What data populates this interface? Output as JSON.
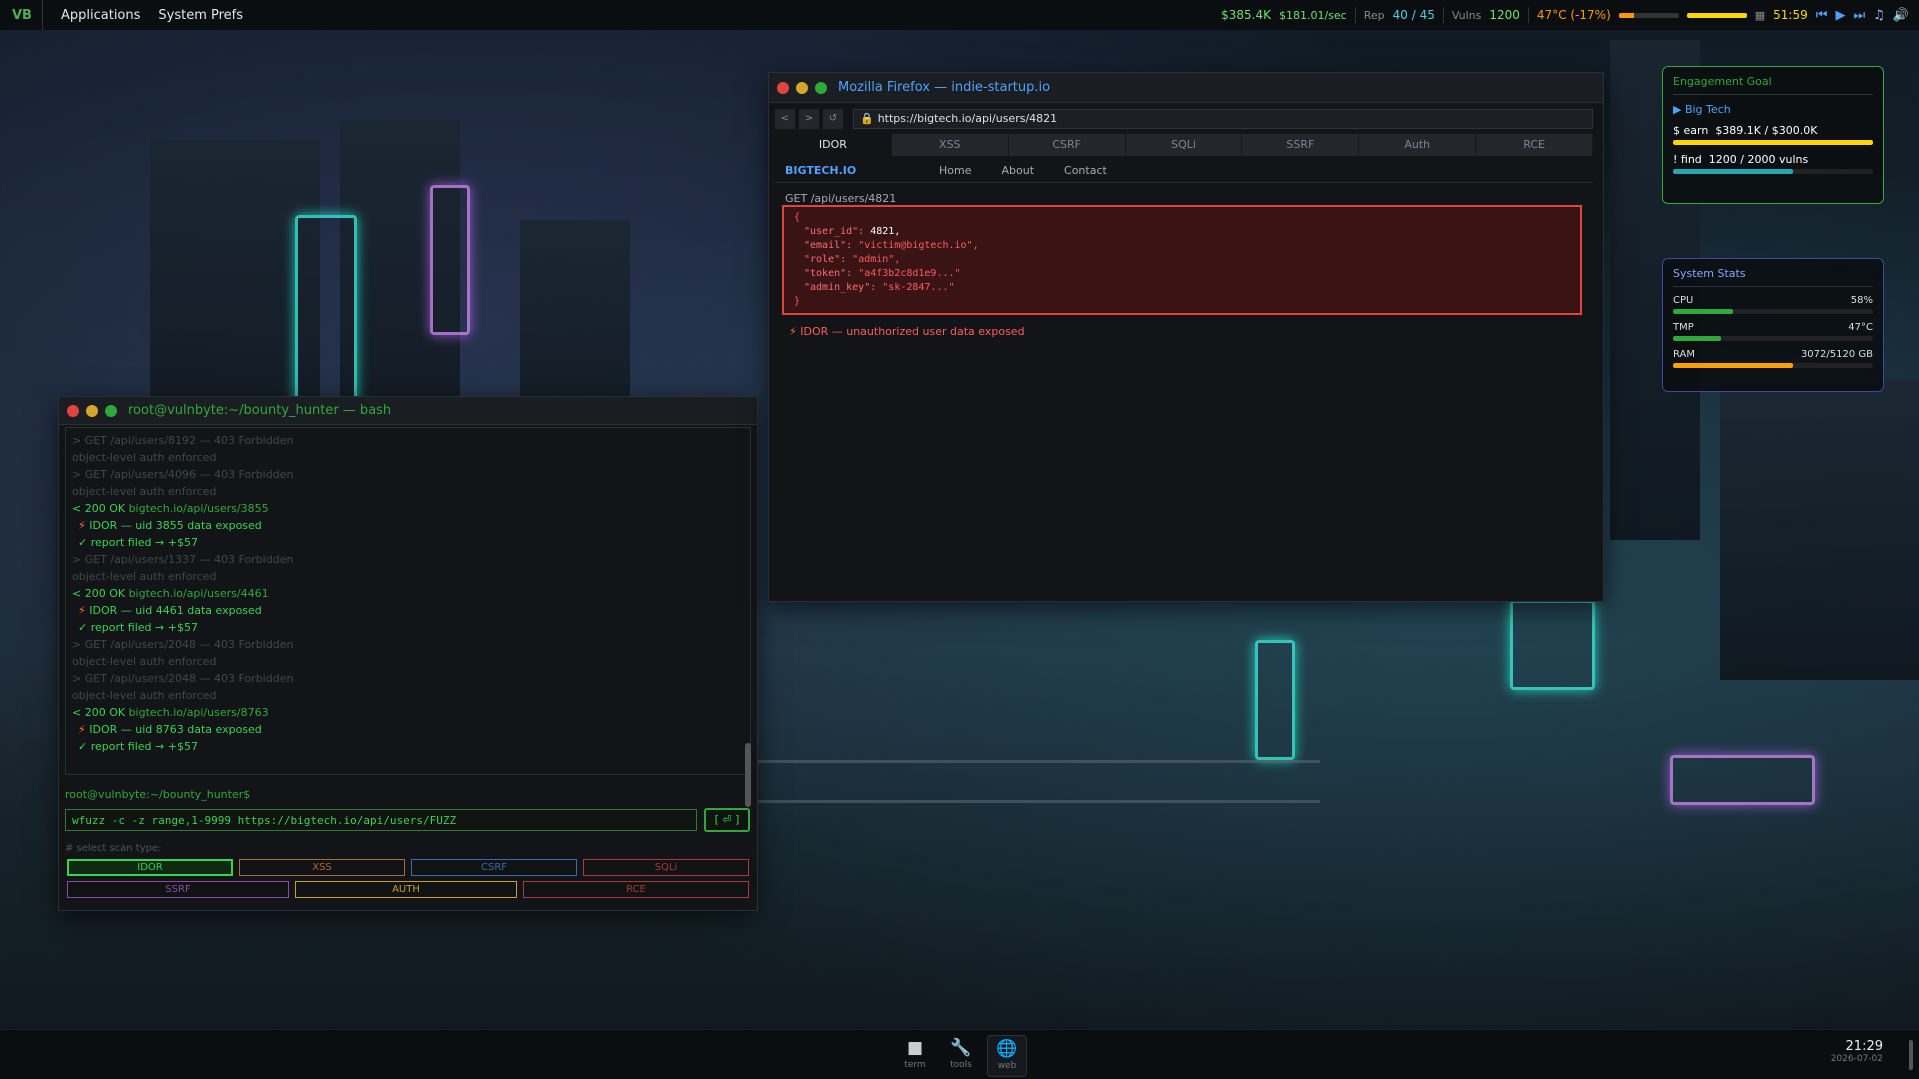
{
  "topbar": {
    "logo": "VB",
    "menus": [
      "Applications",
      "System Prefs"
    ],
    "money": "$385.4K",
    "rate": "$181.01/sec",
    "rep_label": "Rep",
    "rep_value": "40 / 45",
    "vulns_label": "Vulns",
    "vulns_value": "1200",
    "temp": "47°C (-17%)",
    "timer": "51:59"
  },
  "terminal": {
    "title": "root@vulnbyte:~/bounty_hunter — bash",
    "log": [
      {
        "type": "dim",
        "text": "> GET /api/users/8192 — 403 Forbidden"
      },
      {
        "type": "dim",
        "text": "  object-level auth enforced"
      },
      {
        "type": "dim",
        "text": "> GET /api/users/4096 — 403 Forbidden"
      },
      {
        "type": "dim",
        "text": "  object-level auth enforced"
      },
      {
        "type": "ok",
        "status": "< 200 OK",
        "host": "bigtech.io/api/users/3855"
      },
      {
        "type": "idor",
        "text": "IDOR — uid 3855 data exposed"
      },
      {
        "type": "report",
        "text": "✓ report filed → +$57"
      },
      {
        "type": "dim",
        "text": "> GET /api/users/1337 — 403 Forbidden"
      },
      {
        "type": "dim",
        "text": "  object-level auth enforced"
      },
      {
        "type": "ok",
        "status": "< 200 OK",
        "host": "bigtech.io/api/users/4461"
      },
      {
        "type": "idor",
        "text": "IDOR — uid 4461 data exposed"
      },
      {
        "type": "report",
        "text": "✓ report filed → +$57"
      },
      {
        "type": "dim",
        "text": "> GET /api/users/2048 — 403 Forbidden"
      },
      {
        "type": "dim",
        "text": "  object-level auth enforced"
      },
      {
        "type": "dim",
        "text": "> GET /api/users/2048 — 403 Forbidden"
      },
      {
        "type": "dim",
        "text": "  object-level auth enforced"
      },
      {
        "type": "ok",
        "status": "< 200 OK",
        "host": "bigtech.io/api/users/8763"
      },
      {
        "type": "idor",
        "text": "IDOR — uid 8763 data exposed"
      },
      {
        "type": "report",
        "text": "✓ report filed → +$57"
      }
    ],
    "prompt": "root@vulnbyte:~/bounty_hunter$",
    "command": "wfuzz -c -z range,1-9999 https://bigtech.io/api/users/FUZZ",
    "run_label": "[ ⏎ ]",
    "scan_label": "# select scan type:",
    "scan_types": [
      {
        "label": "IDOR",
        "color": "#39d353",
        "active": true
      },
      {
        "label": "XSS",
        "color": "#b0673a"
      },
      {
        "label": "CSRF",
        "color": "#3f6aa8"
      },
      {
        "label": "SQLi",
        "color": "#a83a3a"
      },
      {
        "label": "SSRF",
        "color": "#8a4aa8"
      },
      {
        "label": "AUTH",
        "color": "#c8a02a"
      },
      {
        "label": "RCE",
        "color": "#a83a3a"
      }
    ]
  },
  "firefox": {
    "title": "Mozilla Firefox — indie-startup.io",
    "nav": [
      "<",
      ">",
      "↺"
    ],
    "url": "https://bigtech.io/api/users/4821",
    "tabs": [
      "IDOR",
      "XSS",
      "CSRF",
      "SQLi",
      "SSRF",
      "Auth",
      "RCE"
    ],
    "site_logo": "BIGTECH.IO",
    "site_links": [
      "Home",
      "About",
      "Contact"
    ],
    "request": "GET /api/users/4821",
    "json_open": "{",
    "json_lines": [
      {
        "key": "\"user_id\": ",
        "value": "4821,",
        "num": true
      },
      {
        "key": "\"email\": ",
        "value": "\"victim@bigtech.io\","
      },
      {
        "key": "\"role\": ",
        "value": "\"admin\","
      },
      {
        "key": "\"token\": ",
        "value": "\"a4f3b2c8d1e9...\""
      },
      {
        "key": "\"admin_key\": ",
        "value": "\"sk-2847...\""
      }
    ],
    "json_close": "}",
    "alert": "IDOR — unauthorized user data exposed"
  },
  "engagement": {
    "title": "Engagement Goal",
    "target": "▶ Big Tech",
    "earn_label": "$  earn",
    "earn_value": "$389.1K / $300.0K",
    "earn_progress": 1.0,
    "find_label": "!  find",
    "find_value": "1200 / 2000 vulns",
    "find_progress": 0.6
  },
  "stats": {
    "title": "System Stats",
    "items": [
      {
        "label": "CPU",
        "value": "58%",
        "progress": 0.3,
        "color": "#2faa3a"
      },
      {
        "label": "TMP",
        "value": "47°C",
        "progress": 0.24,
        "color": "#2faa3a"
      },
      {
        "label": "RAM",
        "value": "3072/5120 GB",
        "progress": 0.6,
        "color": "#ffa000"
      }
    ]
  },
  "dock": {
    "items": [
      {
        "label": "term",
        "icon": "■"
      },
      {
        "label": "tools",
        "icon": "🔧"
      },
      {
        "label": "web",
        "icon": "🌐"
      }
    ],
    "time": "21:29",
    "date": "2026-07-02"
  }
}
